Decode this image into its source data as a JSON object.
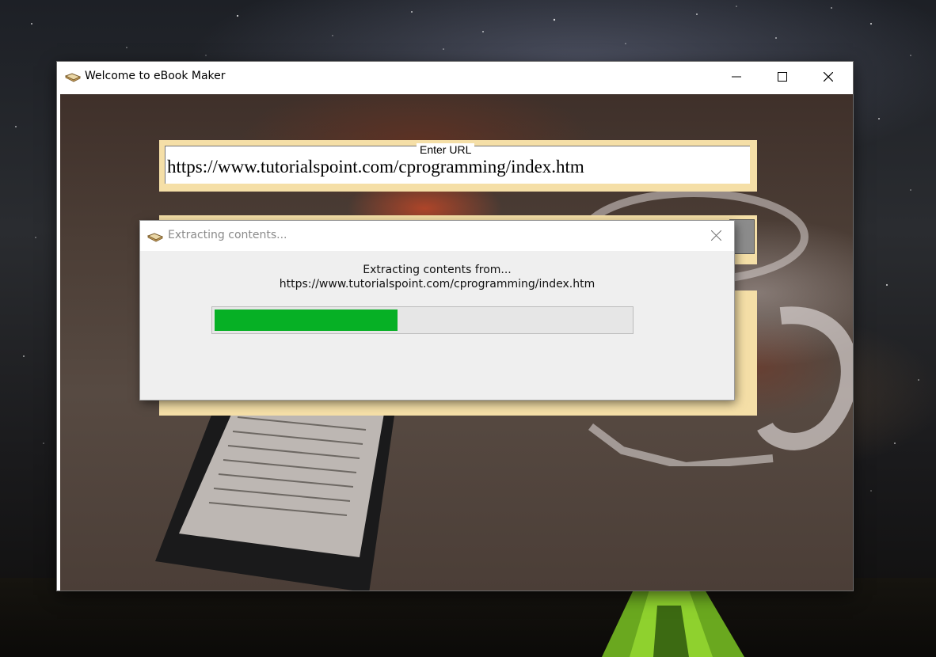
{
  "main_window": {
    "title": "Welcome to eBook Maker",
    "url_field": {
      "label": "Enter URL",
      "value": "https://www.tutorialspoint.com/cprogramming/index.htm"
    }
  },
  "dialog": {
    "title": "Extracting contents...",
    "message_line1": "Extracting contents from...",
    "message_line2": "https://www.tutorialspoint.com/cprogramming/index.htm",
    "progress_fraction": 0.44
  },
  "colors": {
    "panel": "#f5dfa7",
    "progress_fill": "#06b025",
    "progress_track": "#e6e6e6"
  },
  "icons": {
    "app": "book-icon",
    "minimize": "minimize-icon",
    "maximize": "maximize-icon",
    "close": "close-icon"
  }
}
